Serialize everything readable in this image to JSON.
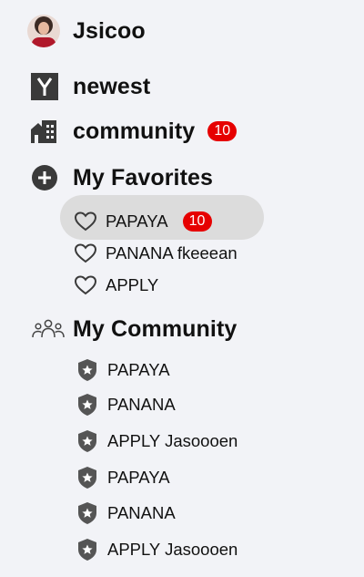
{
  "user": {
    "name": "Jsicoo"
  },
  "nav": {
    "newest": {
      "label": "newest",
      "icon": "y-logo-icon"
    },
    "community": {
      "label": "community",
      "icon": "building-icon",
      "badge": "10"
    }
  },
  "favorites": {
    "header": "My Favorites",
    "icon": "plus-circle-icon",
    "items": [
      {
        "label": "PAPAYA",
        "badge": "10",
        "selected": true,
        "icon": "heart-outline-icon"
      },
      {
        "label": "PANANA fkeeean",
        "icon": "heart-outline-icon"
      },
      {
        "label": "APPLY",
        "icon": "heart-outline-icon"
      }
    ]
  },
  "my_community": {
    "header": "My Community",
    "icon": "people-group-icon",
    "items": [
      {
        "label": "PAPAYA",
        "icon": "shield-star-icon"
      },
      {
        "label": "PANANA",
        "icon": "shield-star-icon"
      },
      {
        "label": "APPLY Jasoooen",
        "icon": "shield-star-icon"
      },
      {
        "label": "PAPAYA",
        "icon": "shield-star-icon"
      },
      {
        "label": "PANANA",
        "icon": "shield-star-icon"
      },
      {
        "label": "APPLY Jasoooen",
        "icon": "shield-star-icon"
      }
    ]
  },
  "colors": {
    "badge": "#e60000",
    "background": "#f2f3f7",
    "selected": "#dcdcdc",
    "icon": "#3a3a3a"
  }
}
